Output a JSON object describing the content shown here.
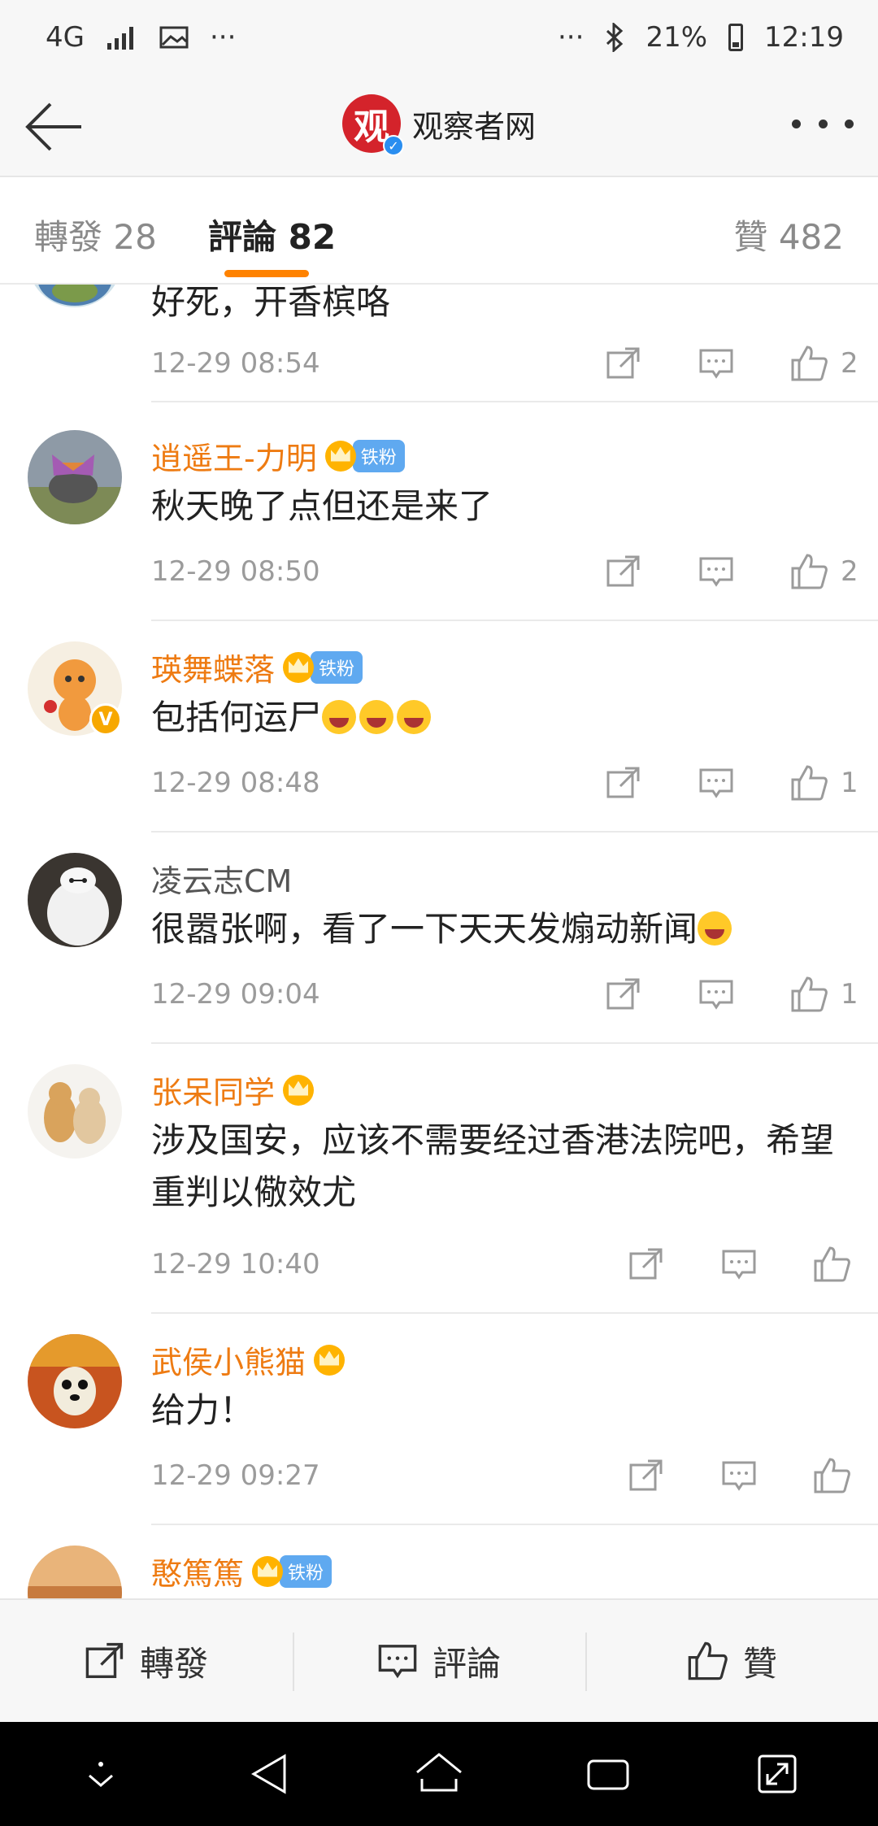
{
  "status_bar": {
    "network": "4G",
    "dots_left": "···",
    "dots_right": "···",
    "battery": "21%",
    "time": "12:19"
  },
  "nav": {
    "logo_char": "观",
    "title": "观察者网"
  },
  "tabs": [
    {
      "label": "轉發 28"
    },
    {
      "label": "評論 82"
    },
    {
      "label": "贊 482"
    }
  ],
  "comments": [
    {
      "avatar": "tortoise-avatar",
      "username": "",
      "text": "好死，开香槟咯",
      "time": "12-29 08:54",
      "likes": "2"
    },
    {
      "avatar": "elephant-butterfly-avatar",
      "username": "逍遥王-力明",
      "badge": "铁粉",
      "text": "秋天晚了点但还是来了",
      "time": "12-29 08:50",
      "likes": "2"
    },
    {
      "avatar": "tiger-avatar",
      "username": "瑛舞蝶落",
      "badge": "铁粉",
      "text": "包括何运尸",
      "time": "12-29 08:48",
      "likes": "1"
    },
    {
      "avatar": "baymax-avatar",
      "username": "凌云志CM",
      "text": "很嚣张啊，看了一下天天发煽动新闻",
      "time": "12-29 09:04",
      "likes": "1"
    },
    {
      "avatar": "cats-avatar",
      "username": "张呆同学",
      "text": "涉及国安，应该不需要经过香港法院吧，希望重判以儆效尤",
      "time": "12-29 10:40",
      "likes": ""
    },
    {
      "avatar": "panda-avatar",
      "username": "武侯小熊猫",
      "text": "给力！",
      "time": "12-29 09:27",
      "likes": ""
    },
    {
      "avatar": "landscape-avatar",
      "username": "憨篤篤",
      "badge": "铁粉"
    }
  ],
  "bottom_bar": {
    "repost": "轉發",
    "comment": "評論",
    "like": "贊"
  },
  "colors": {
    "accent": "#ff8200",
    "username_orange": "#ee7b12",
    "badge_blue": "#5fa9f0",
    "brand_red": "#d4232b"
  }
}
